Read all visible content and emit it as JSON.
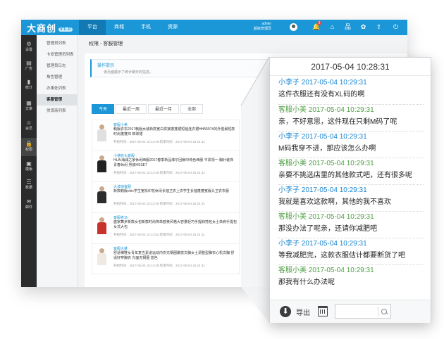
{
  "app": {
    "logo_text": "大商创",
    "logo_version": "V1.0",
    "top_nav": [
      "平台",
      "商城",
      "手机",
      "资源"
    ],
    "user": {
      "name": "admin",
      "role": "超级管理员"
    },
    "notification_count": "3"
  },
  "sidebar": [
    {
      "icon": "gear-icon",
      "glyph": "⚙",
      "label": "设置"
    },
    {
      "icon": "ad-icon",
      "glyph": "▤",
      "label": "广告"
    },
    {
      "icon": "stats-icon",
      "glyph": "▮",
      "label": "统计"
    },
    {
      "icon": "article-icon",
      "glyph": "▦",
      "label": "文章"
    },
    {
      "icon": "member-icon",
      "glyph": "☺",
      "label": "会员"
    },
    {
      "icon": "lock-icon",
      "glyph": "🔒",
      "label": "权限"
    },
    {
      "icon": "template-icon",
      "glyph": "▣",
      "label": "模板"
    },
    {
      "icon": "data-icon",
      "glyph": "☰",
      "label": "数据"
    },
    {
      "icon": "mail-icon",
      "glyph": "✉",
      "label": "邮件"
    }
  ],
  "subnav": [
    "管理员列表",
    "卡发管理员列表",
    "管理员日志",
    "角色管理",
    "办事处列表",
    "客服管理",
    "供货商列表"
  ],
  "main": {
    "breadcrumb": "权限 - 客服管理",
    "tip_title": "操作提示",
    "tip_text": "· 该页面展示了统计聊天的信息。",
    "tabs": [
      "今天",
      "最近一周",
      "最近一月",
      "全部"
    ],
    "rows": [
      {
        "name": "客服小美",
        "desc": "韩版衣衣2017韩版女装新款宽白拼接蓬蓬裙短袖连衣裙HH5597#的外借最短款 时尚蓬蓬帅 棉球裙",
        "time": "开始时间：2017-05-04 15:13:49    结束时间：2017-05-04 15:24:31",
        "color": "#e0e0e0"
      },
      {
        "name": "小巷奶头客服",
        "desc": "HLA/海澜之家休闲西服2017春季新品菲尔回暖印纯色西服 平驳领一 胸针装饰 青春休闲 男装HSSE7",
        "time": "开始时间：2017-05-04 15:13:49    结束时间：2017-05-04 15:24:31",
        "color": "#222222"
      },
      {
        "name": "大波浪客服",
        "desc": "新款韩版chic学生宽松印花休闲长袖卫衣上衣学生长袖蓬蓬宽版头卫衣衣服",
        "time": "开始时间：2017-05-04 15:13:49    结束时间：2017-05-04 15:24:31",
        "color": "#2c2c2c"
      },
      {
        "name": "客服老马",
        "desc": "盛家舞步新款女包新款时尚简单欧美风格大容量轻巧手提斜挎包女士单肩手提包女式大包",
        "time": "开始时间：2017-05-04 14:12:52    结束时间：2017-05-04 15:24:31",
        "color": "#c7322b"
      },
      {
        "name": "客服大雄",
        "desc": "舒适裸鞋女青年复古素道运动内衣无钢圈聚拢文胸女士调整型胸衣心机文胸 舒适好穿胸衣 光面无钢圈 蓝色",
        "time": "开始时间：2017-05-04 15:13:49    结束时间：2017-05-04 15:24:31",
        "color": "#efe9e3"
      }
    ],
    "peek_export": "导出"
  },
  "chat": {
    "header": "2017-05-04 10:28:31",
    "messages": [
      {
        "sender": "小李子",
        "time": "2017-05-04 10:29:31",
        "text": "这件衣服还有没有XL码的啊",
        "role": "customer"
      },
      {
        "sender": "客服小美",
        "time": "2017-05-04 10:29:31",
        "text": "亲，不好意思，这件现在只剩M码了呢",
        "role": "service"
      },
      {
        "sender": "小李子",
        "time": "2017-05-04 10:29:31",
        "text": "M码我穿不进，那应该怎么办啊",
        "role": "customer"
      },
      {
        "sender": "客服小美",
        "time": "2017-05-04 10:29:31",
        "text": "亲要不挑选店里的其他款式吧，还有很多呢",
        "role": "service"
      },
      {
        "sender": "小李子",
        "time": "2017-05-04 10:29:31",
        "text": "我就是喜欢这款啊，其他的我不喜欢",
        "role": "customer"
      },
      {
        "sender": "客服小美",
        "time": "2017-05-04 10:29:31",
        "text": "那没办法了呢亲，还请你减肥吧",
        "role": "service"
      },
      {
        "sender": "小李子",
        "time": "2017-05-04 10:29:31",
        "text": "等我减肥完，这款衣服估计都要断货了吧",
        "role": "customer"
      },
      {
        "sender": "客服小美",
        "time": "2017-05-04 10:29:31",
        "text": "那我有什么办法呢",
        "role": "service"
      }
    ],
    "footer": {
      "export_label": "导出",
      "search_placeholder": ""
    }
  }
}
